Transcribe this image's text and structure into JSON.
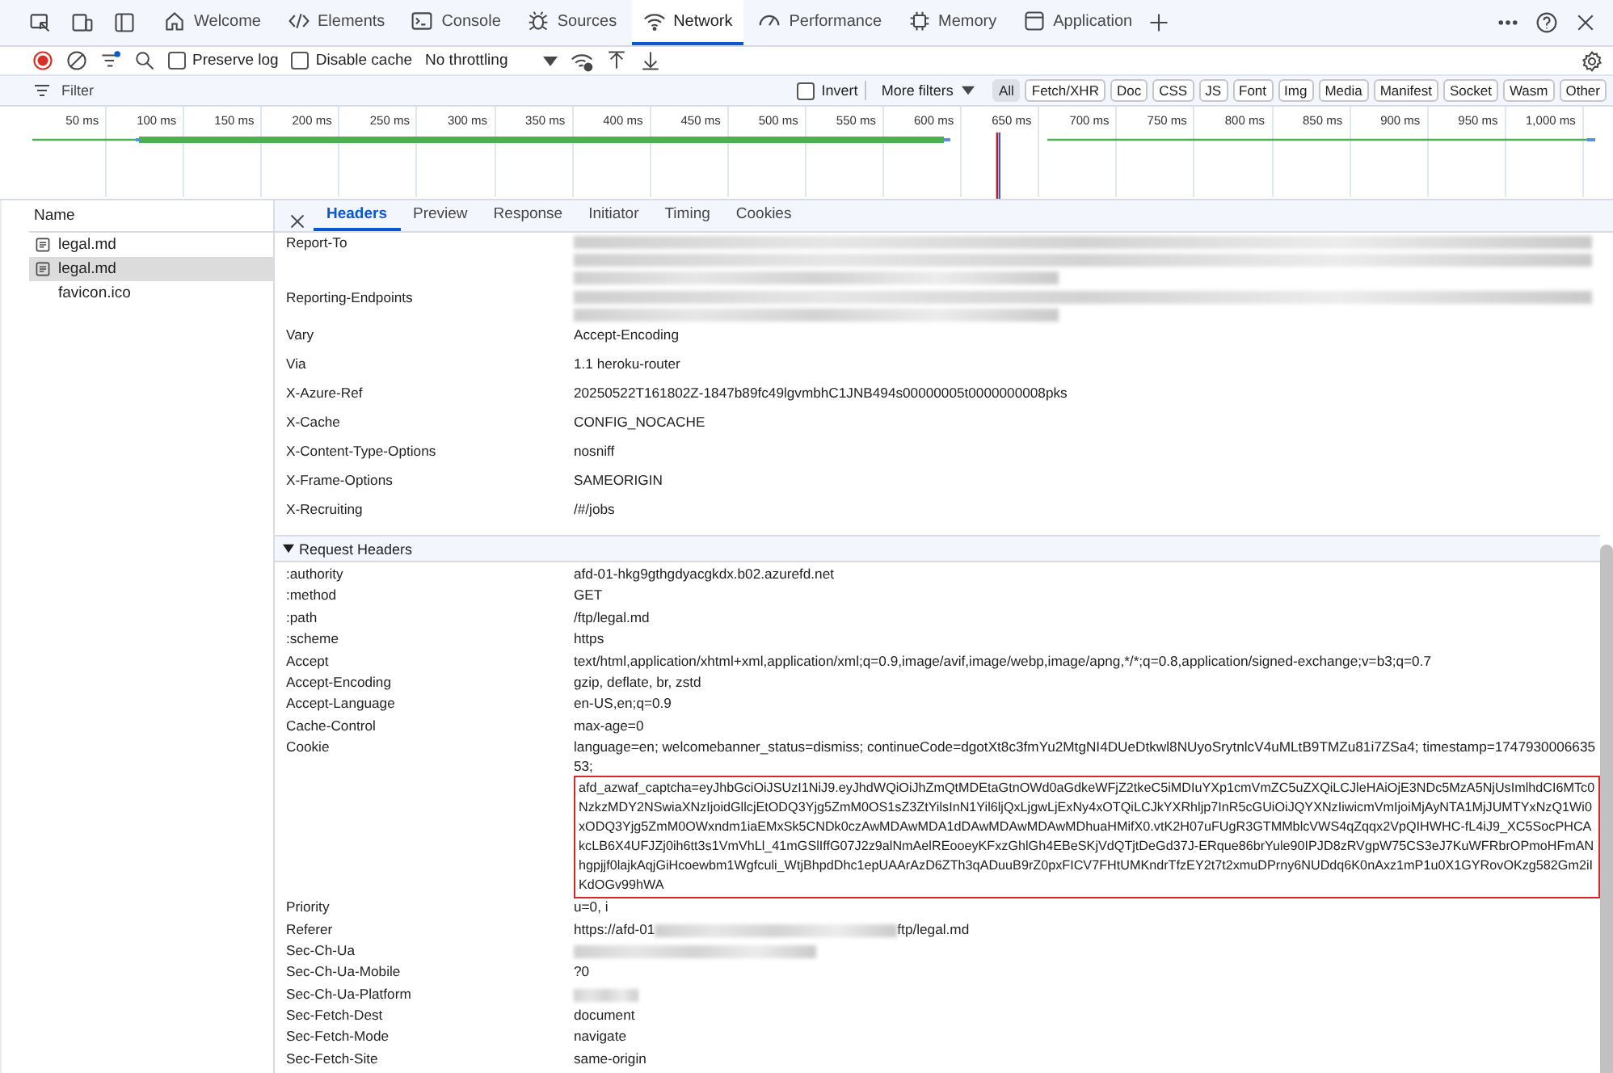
{
  "main_tabs": [
    {
      "kind": "welcome",
      "label": "Welcome",
      "selected": false
    },
    {
      "kind": "elements",
      "label": "Elements",
      "selected": false
    },
    {
      "kind": "console",
      "label": "Console",
      "selected": false
    },
    {
      "kind": "sources",
      "label": "Sources",
      "selected": false
    },
    {
      "kind": "network",
      "label": "Network",
      "selected": true
    },
    {
      "kind": "performance",
      "label": "Performance",
      "selected": false
    },
    {
      "kind": "memory",
      "label": "Memory",
      "selected": false
    },
    {
      "kind": "application",
      "label": "Application",
      "selected": false
    }
  ],
  "toolbar": {
    "recording": true,
    "preserve_log": {
      "label": "Preserve log",
      "checked": false
    },
    "disable_cache": {
      "label": "Disable cache",
      "checked": false
    },
    "throttling": "No throttling"
  },
  "filter": {
    "placeholder": "Filter",
    "invert": {
      "label": "Invert",
      "checked": false
    },
    "more_filters": "More filters",
    "types": [
      {
        "label": "All",
        "selected": true
      },
      {
        "label": "Fetch/XHR",
        "selected": false
      },
      {
        "label": "Doc",
        "selected": false
      },
      {
        "label": "CSS",
        "selected": false
      },
      {
        "label": "JS",
        "selected": false
      },
      {
        "label": "Font",
        "selected": false
      },
      {
        "label": "Img",
        "selected": false
      },
      {
        "label": "Media",
        "selected": false
      },
      {
        "label": "Manifest",
        "selected": false
      },
      {
        "label": "Socket",
        "selected": false
      },
      {
        "label": "Wasm",
        "selected": false
      },
      {
        "label": "Other",
        "selected": false
      }
    ]
  },
  "timeline": {
    "ticks": [
      "50 ms",
      "100 ms",
      "150 ms",
      "200 ms",
      "250 ms",
      "300 ms",
      "350 ms",
      "400 ms",
      "450 ms",
      "500 ms",
      "550 ms",
      "600 ms",
      "650 ms",
      "700 ms",
      "750 ms",
      "800 ms",
      "850 ms",
      "900 ms",
      "950 ms",
      "1,000 ms"
    ]
  },
  "requests": {
    "column": "Name",
    "rows": [
      {
        "kind": "document",
        "name": "legal.md",
        "selected": false
      },
      {
        "kind": "document",
        "name": "legal.md",
        "selected": true
      },
      {
        "kind": "plain",
        "name": "favicon.ico",
        "selected": false
      }
    ]
  },
  "details": {
    "tabs": [
      {
        "label": "Headers",
        "selected": true
      },
      {
        "label": "Preview",
        "selected": false
      },
      {
        "label": "Response",
        "selected": false
      },
      {
        "label": "Initiator",
        "selected": false
      },
      {
        "label": "Timing",
        "selected": false
      },
      {
        "label": "Cookies",
        "selected": false
      }
    ],
    "response_headers": [
      {
        "name": "Report-To",
        "parts": [
          {
            "kind": "blur-line"
          },
          {
            "kind": "blur-line"
          },
          {
            "kind": "blur-short"
          }
        ]
      },
      {
        "name": "Reporting-Endpoints",
        "parts": [
          {
            "kind": "blur-line"
          },
          {
            "kind": "blur-short"
          }
        ]
      },
      {
        "name": "Vary",
        "parts": [
          {
            "kind": "text",
            "text": "Accept-Encoding"
          }
        ]
      },
      {
        "name": "Via",
        "parts": [
          {
            "kind": "text",
            "text": "1.1 heroku-router"
          }
        ]
      },
      {
        "name": "X-Azure-Ref",
        "parts": [
          {
            "kind": "text",
            "text": "20250522T161802Z-1847b89fc49lgvmbhC1JNB494s00000005t0000000008pks"
          }
        ]
      },
      {
        "name": "X-Cache",
        "parts": [
          {
            "kind": "text",
            "text": "CONFIG_NOCACHE"
          }
        ]
      },
      {
        "name": "X-Content-Type-Options",
        "parts": [
          {
            "kind": "text",
            "text": "nosniff"
          }
        ]
      },
      {
        "name": "X-Frame-Options",
        "parts": [
          {
            "kind": "text",
            "text": "SAMEORIGIN"
          }
        ]
      },
      {
        "name": "X-Recruiting",
        "parts": [
          {
            "kind": "text",
            "text": "/#/jobs"
          }
        ]
      }
    ],
    "request_headers": {
      "title": "Request Headers",
      "expanded": true,
      "rows": [
        {
          "name": ":authority",
          "parts": [
            {
              "kind": "text",
              "text": "afd-01-hkg9gthgdyacgkdx.b02.azurefd.net"
            }
          ]
        },
        {
          "name": ":method",
          "parts": [
            {
              "kind": "text",
              "text": "GET"
            }
          ]
        },
        {
          "name": ":path",
          "parts": [
            {
              "kind": "text",
              "text": "/ftp/legal.md"
            }
          ]
        },
        {
          "name": ":scheme",
          "parts": [
            {
              "kind": "text",
              "text": "https"
            }
          ]
        },
        {
          "name": "Accept",
          "parts": [
            {
              "kind": "text",
              "text": "text/html,application/xhtml+xml,application/xml;q=0.9,image/avif,image/webp,image/apng,*/*;q=0.8,application/signed-exchange;v=b3;q=0.7"
            }
          ]
        },
        {
          "name": "Accept-Encoding",
          "parts": [
            {
              "kind": "text",
              "text": "gzip, deflate, br, zstd"
            }
          ]
        },
        {
          "name": "Accept-Language",
          "parts": [
            {
              "kind": "text",
              "text": "en-US,en;q=0.9"
            }
          ]
        },
        {
          "name": "Cache-Control",
          "parts": [
            {
              "kind": "text",
              "text": "max-age=0"
            }
          ]
        },
        {
          "name": "Cookie",
          "parts": [
            {
              "kind": "text",
              "text": "language=en; welcomebanner_status=dismiss; continueCode=dgotXt8c3fmYu2MtgNI4DUeDtkwl8NUyoSrytnlcV4uMLtB9TMZu81i7ZSa4; timestamp=174793000663553;"
            },
            {
              "kind": "highlighted",
              "text": "afd_azwaf_captcha=eyJhbGciOiJSUzI1NiJ9.eyJhdWQiOiJhZmQtMDEtaGtnOWd0aGdkeWFjZ2tkeC5iMDIuYXp1cmVmZC5uZXQiLCJleHAiOjE3NDc5MzA5NjUsImlhdCI6MTc0NzkzMDY2NSwiaXNzIjoidGllcjEtODQ3Yjg5ZmM0OS1sZ3ZtYilsInN1Yil6ljQxLjgwLjExNy4xOTQiLCJkYXRhljp7InR5cGUiOiJQYXNzIiwicmVmIjoiMjAyNTA1MjJUMTYxNzQ1Wi0xODQ3Yjg5ZmM0OWxndm1iaEMxSk5CNDk0czAwMDAwMDA1dDAwMDAwMDAwMDhuaHMifX0.vtK2H07uFUgR3GTMMblcVWS4qZqqx2VpQIHWHC-fL4iJ9_XC5SocPHCAkcLB6X4UFJZj0ih6tt3s1VmVhLl_41mGSlIffG07J2z9alNmAelREooeyKFxzGhlGh4EBeSKjVdQTjtDeGd37J-ERque86brYule90IPJD8zRVgpW75CS3eJ7KuWFRbrOPmoHFmANhgpjjf0lajkAqjGiHcoewbm1Wgfculi_WtjBhpdDhc1epUAArAzD6ZTh3qADuuB9rZ0pxFICV7FHtUMKndrTfzEY2t7t2xmuDPrny6NUDdq6K0nAxz1mP1u0X1GYRovOKzg582Gm2iIKdOGv99hWA"
            }
          ]
        },
        {
          "name": "Priority",
          "parts": [
            {
              "kind": "text",
              "text": "u=0, i"
            }
          ]
        },
        {
          "name": "Referer",
          "parts": [
            {
              "kind": "text",
              "text": "https://afd-01"
            },
            {
              "kind": "blur-inline"
            },
            {
              "kind": "text",
              "text": "ftp/legal.md"
            }
          ]
        },
        {
          "name": "Sec-Ch-Ua",
          "parts": [
            {
              "kind": "blur-inline"
            }
          ]
        },
        {
          "name": "Sec-Ch-Ua-Mobile",
          "parts": [
            {
              "kind": "text",
              "text": "?0"
            }
          ]
        },
        {
          "name": "Sec-Ch-Ua-Platform",
          "parts": [
            {
              "kind": "blur-small"
            }
          ]
        },
        {
          "name": "Sec-Fetch-Dest",
          "parts": [
            {
              "kind": "text",
              "text": "document"
            }
          ]
        },
        {
          "name": "Sec-Fetch-Mode",
          "parts": [
            {
              "kind": "text",
              "text": "navigate"
            }
          ]
        },
        {
          "name": "Sec-Fetch-Site",
          "parts": [
            {
              "kind": "text",
              "text": "same-origin"
            }
          ]
        }
      ]
    }
  }
}
